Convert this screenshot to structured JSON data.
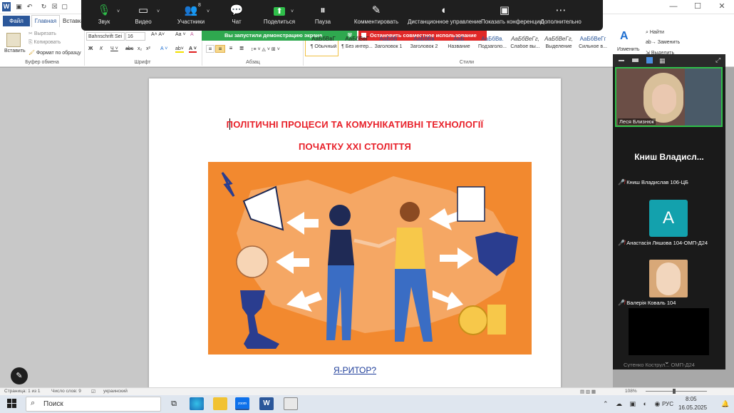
{
  "word": {
    "file_tab": "Файл",
    "tabs": [
      "Главная",
      "Вставка"
    ],
    "clipboard": {
      "paste": "Вставить",
      "cut": "Вырезать",
      "copy": "Копировать",
      "format_painter": "Формат по образцу",
      "group": "Буфер обмена"
    },
    "font": {
      "name": "Bahnschrift Sei",
      "size": "16",
      "group": "Шрифт"
    },
    "paragraph_group": "Абзац",
    "styles": [
      {
        "preview": "АаБбВвГ",
        "name": "¶ Обычный"
      },
      {
        "preview": "АаБбВвГ",
        "name": "¶ Без интер..."
      },
      {
        "preview": "АаБбВ",
        "name": "Заголовок 1"
      },
      {
        "preview": "АаБбВв",
        "name": "Заголовок 2"
      },
      {
        "preview": "АаБ",
        "name": "Название"
      },
      {
        "preview": "АаБбВв.",
        "name": "Подзаголо..."
      },
      {
        "preview": "АаБбВеГг,",
        "name": "Слабое вы..."
      },
      {
        "preview": "АаБбВеГг,",
        "name": "Выделение"
      },
      {
        "preview": "АаБбВеГг",
        "name": "Сильное в..."
      }
    ],
    "styles_group": "Стили",
    "change_styles": "Изменить",
    "editing": {
      "find": "Найти",
      "replace": "Заменить",
      "select": "Выделить"
    },
    "status": {
      "page": "Страница: 1 из 1",
      "words": "Число слов: 9",
      "language": "украинский",
      "zoom": "108%"
    }
  },
  "document": {
    "title_line1": "ПОЛІТИЧНІ ПРОЦЕСИ ТА КОМУНІКАТИВНІ ТЕХНОЛОГІЇ",
    "title_line2": "ПОЧАТКУ XXI СТОЛІТТЯ",
    "link_text": "Я-РИТОР?"
  },
  "zoom": {
    "toolbar": [
      {
        "label": "Звук",
        "icon": "mic-icon"
      },
      {
        "label": "Видео",
        "icon": "video-icon"
      },
      {
        "label": "Участники",
        "icon": "participants-icon",
        "count": "8"
      },
      {
        "label": "Чат",
        "icon": "chat-icon"
      },
      {
        "label": "Поделиться",
        "icon": "share-icon"
      },
      {
        "label": "Пауза",
        "icon": "pause-icon"
      },
      {
        "label": "Комментировать",
        "icon": "annotate-icon"
      },
      {
        "label": "Дистанционное управление",
        "icon": "remote-control-icon"
      },
      {
        "label": "Показать конференцию",
        "icon": "show-meeting-icon"
      },
      {
        "label": "Дополнительно",
        "icon": "more-icon"
      }
    ],
    "share_banner": "Вы запустили демонстрацию экрана",
    "stop_share": "Остановить совместное использование",
    "participants": {
      "video_name": "Леся Близнюк",
      "big_name": "Книш  Владисл...",
      "list": [
        {
          "name": "Книш Владислав 106-ЦБ"
        },
        {
          "name": "Анастасія Ляшова 104-ОМП-Д24",
          "avatar_letter": "A"
        },
        {
          "name": "Валерія Коваль 104"
        }
      ],
      "cutoff_name": "Сутенко Кострул... ОМП-Д24"
    }
  },
  "taskbar": {
    "search": "Поиск",
    "lang": "РУС",
    "time": "8:05",
    "date": "16.05.2025"
  },
  "colors": {
    "word_blue": "#2b579a",
    "doc_title_red": "#e8212a",
    "illustration_orange": "#f2892f",
    "zoom_green": "#2fa84f",
    "zoom_red": "#e02828"
  }
}
